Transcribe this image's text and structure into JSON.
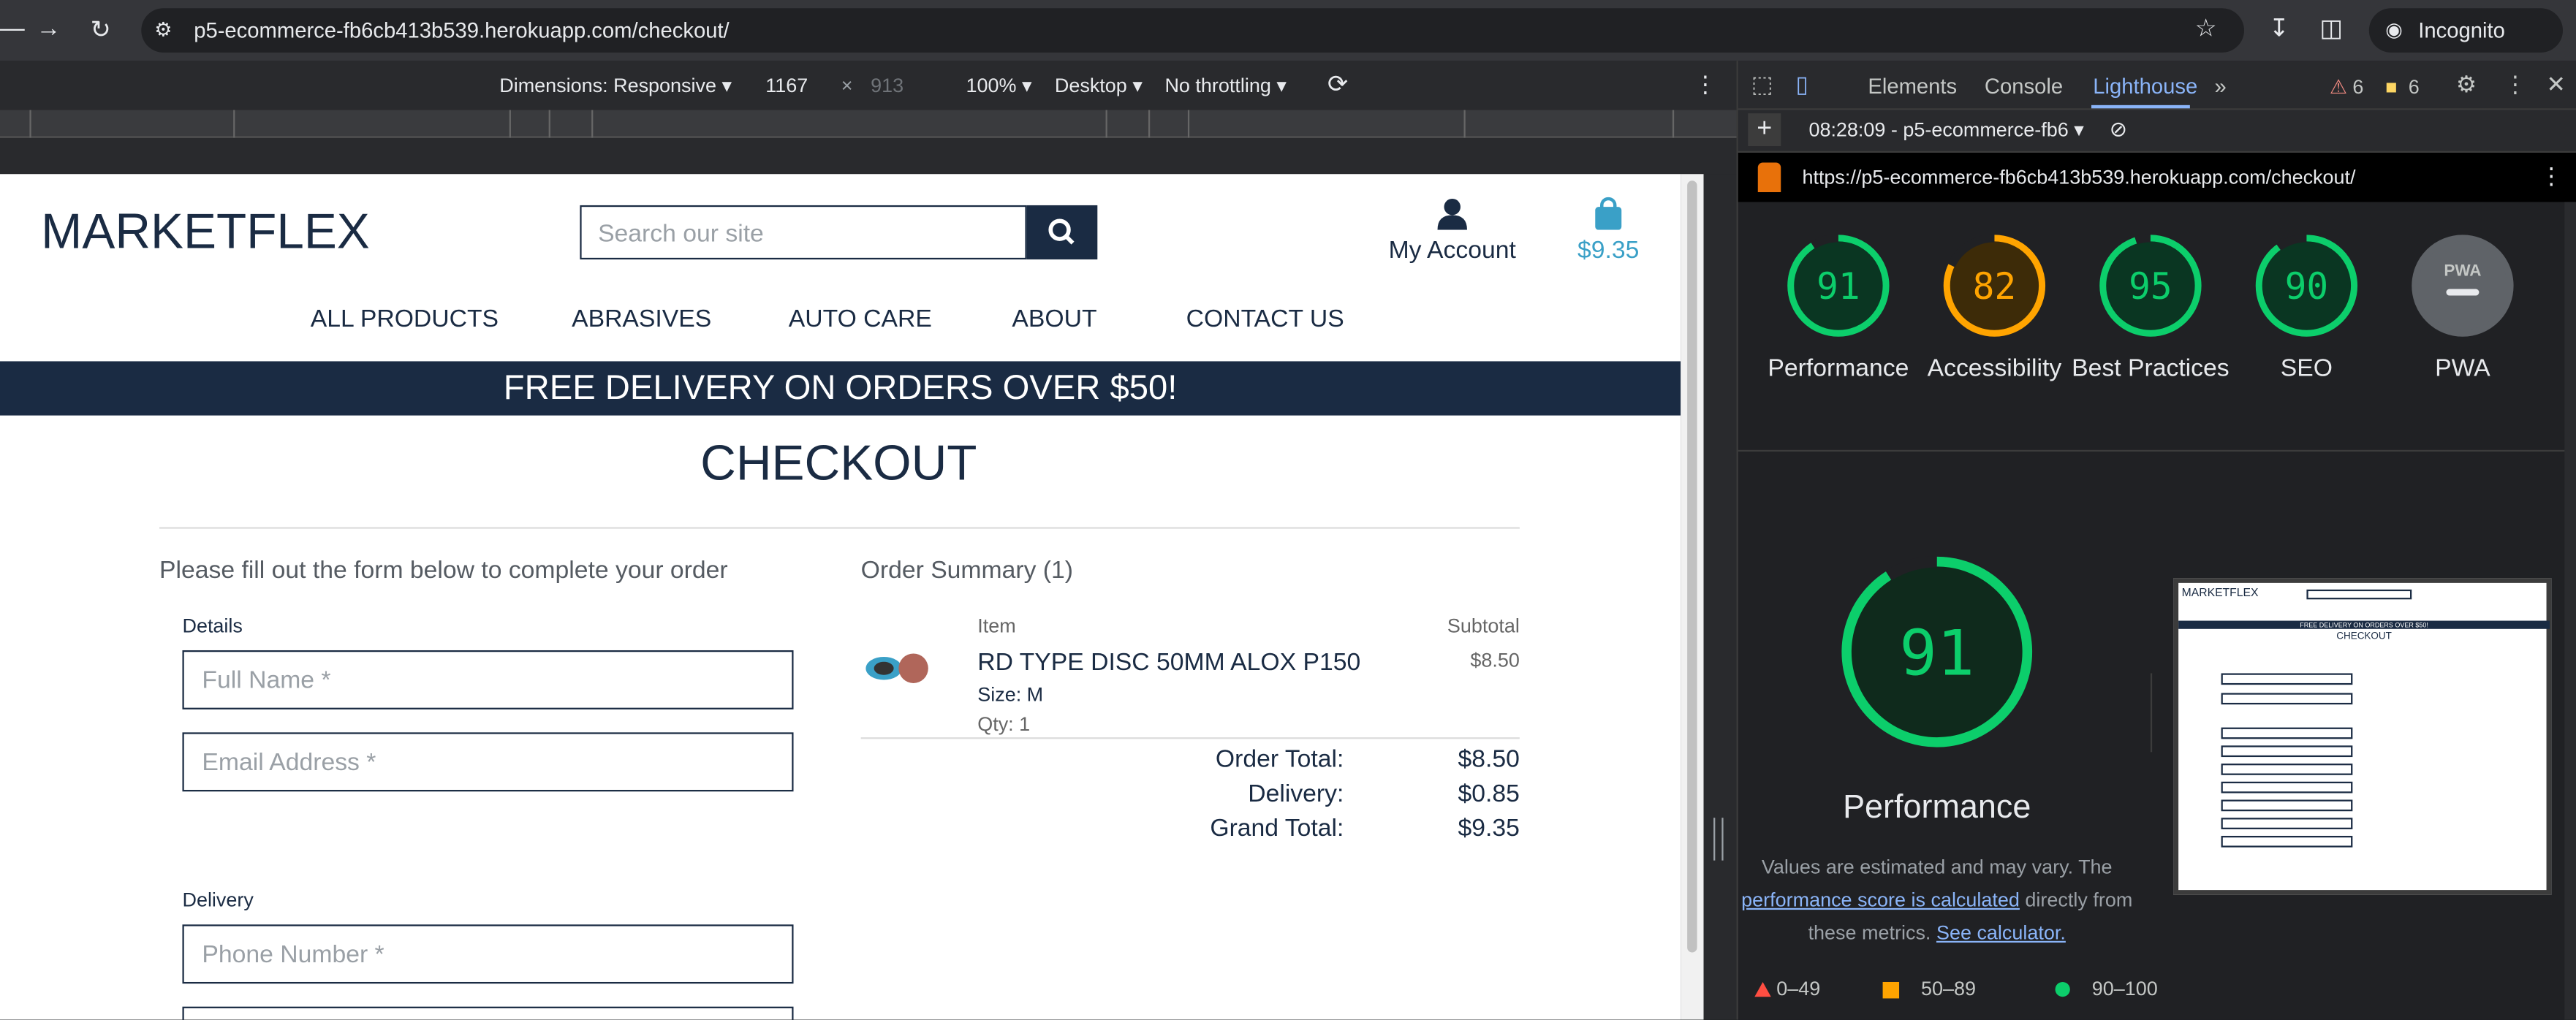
{
  "browser": {
    "url": "p5-ecommerce-fb6cb413b539.herokuapp.com/checkout/",
    "incognito_label": "Incognito"
  },
  "device_toolbar": {
    "dimensions": "Dimensions: Responsive",
    "width": "1167",
    "times": "×",
    "height": "913",
    "zoom": "100%",
    "device": "Desktop",
    "throttling": "No throttling"
  },
  "site": {
    "logo": "MARKETFLEX",
    "search_placeholder": "Search our site",
    "account_label": "My Account",
    "cart_total": "$9.35",
    "nav": [
      "ALL PRODUCTS",
      "ABRASIVES",
      "AUTO CARE",
      "ABOUT",
      "CONTACT US"
    ],
    "banner": "FREE DELIVERY ON ORDERS OVER $50!",
    "page_title": "CHECKOUT",
    "form_intro": "Please fill out the form below to complete your order",
    "details_heading": "Details",
    "full_name_placeholder": "Full Name *",
    "email_placeholder": "Email Address *",
    "delivery_heading": "Delivery",
    "phone_placeholder": "Phone Number *",
    "summary_title": "Order Summary (1)",
    "item_header": "Item",
    "subtotal_header": "Subtotal",
    "item": {
      "name": "RD TYPE DISC 50MM ALOX P150",
      "size": "Size: M",
      "qty": "Qty: 1",
      "subtotal": "$8.50"
    },
    "totals": [
      {
        "label": "Order Total:",
        "value": "$8.50"
      },
      {
        "label": "Delivery:",
        "value": "$0.85"
      },
      {
        "label": "Grand Total:",
        "value": "$9.35"
      }
    ]
  },
  "devtools": {
    "tabs": [
      "Elements",
      "Console",
      "Lighthouse"
    ],
    "active_tab": "Lighthouse",
    "warnings": "6",
    "issues": "6",
    "report_time": "08:28:09 - p5-ecommerce-fb6",
    "report_url": "https://p5-ecommerce-fb6cb413b539.herokuapp.com/checkout/",
    "scores": [
      {
        "label": "Performance",
        "value": 91,
        "color": "#0cce6b"
      },
      {
        "label": "Accessibility",
        "value": 82,
        "color": "#ffa400"
      },
      {
        "label": "Best Practices",
        "value": 95,
        "color": "#0cce6b"
      },
      {
        "label": "SEO",
        "value": 90,
        "color": "#0cce6b"
      },
      {
        "label": "PWA",
        "value": "PWA",
        "color": "#5f6368"
      }
    ],
    "big_score": 91,
    "big_label": "Performance",
    "desc_1": "Values are estimated and may vary. The",
    "desc_link_1": "performance score is calculated",
    "desc_2": "directly from",
    "desc_3": "these metrics.",
    "desc_link_2": "See calculator.",
    "legend": [
      "0–49",
      "50–89",
      "90–100"
    ]
  }
}
